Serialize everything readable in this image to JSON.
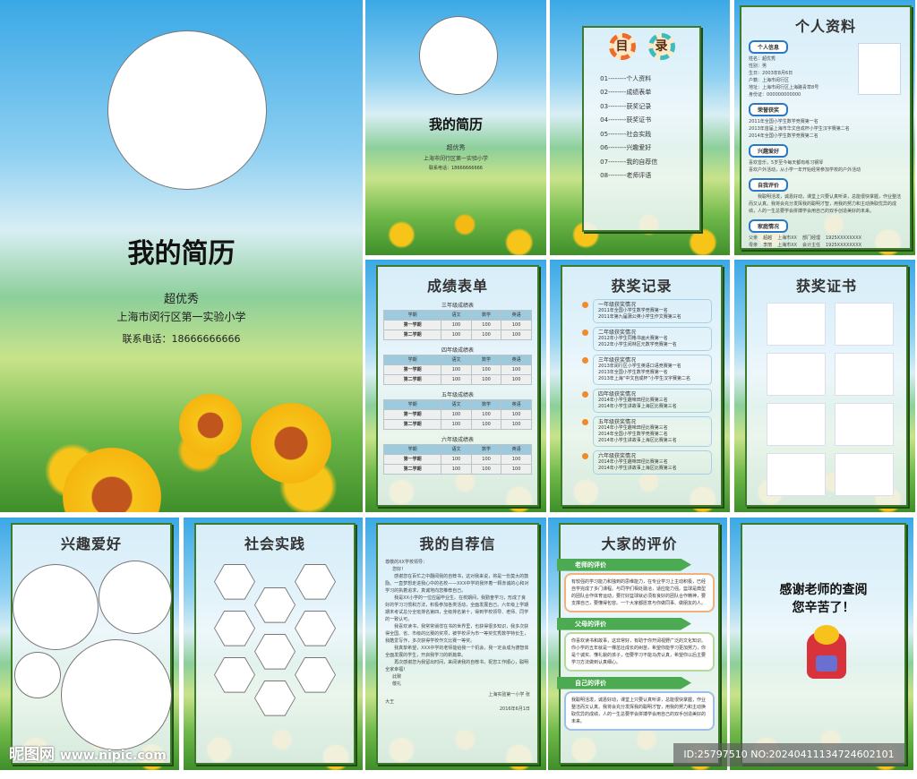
{
  "cover": {
    "title": "我的简历",
    "name": "超优秀",
    "school": "上海市闵行区第一实验小学",
    "phone": "联系电话：18666666666"
  },
  "cover2": {
    "title": "我的简历",
    "name": "超优秀",
    "school": "上海市闵行区第一实验小学",
    "phone": "联系电话：18666666666"
  },
  "toc": {
    "char1": "目",
    "char2": "录",
    "items": [
      {
        "num": "01",
        "label": "个人资料"
      },
      {
        "num": "02",
        "label": "成绩表单"
      },
      {
        "num": "03",
        "label": "获奖记录"
      },
      {
        "num": "04",
        "label": "获奖证书"
      },
      {
        "num": "05",
        "label": "社会实践"
      },
      {
        "num": "06",
        "label": "兴趣爱好"
      },
      {
        "num": "07",
        "label": "我的自荐信"
      },
      {
        "num": "08",
        "label": "老师评语"
      }
    ]
  },
  "profile": {
    "title": "个人资料",
    "sec_info": "个人信息",
    "info": [
      "姓名：超优秀",
      "性别：男",
      "生日：2003年8月6日",
      "户籍：上海市闵行区",
      "地址：上海市闵行区上海路青草8号",
      "身份证：000000000000"
    ],
    "sec_honor": "荣誉获奖",
    "honors": [
      "2011年全国小学生数学竞赛第一名",
      "2013年首届上海市华文自成杯小学生汉字赛第二名",
      "2014年全国小学生数学竞赛第二名"
    ],
    "sec_hobby": "兴趣爱好",
    "hobbies": [
      "喜欢音乐，5岁至今每天都有练习钢琴",
      "喜欢户外活动，从小学一年开始经常参加学校的户外活动"
    ],
    "sec_self": "自我评价",
    "self": "我聪明活泼，诚恳好动，课堂上只要认真听讲，总能很快掌握，作业整洁而又认真。我将会充分发挥我的聪明才智，用我的努力和主动换取优异的成绩，人的一生总要学会拼搏学会用自己的双手创造美好的未来。",
    "sec_family": "家庭情况",
    "family": [
      [
        "父亲",
        "超越",
        "上海市XX",
        "部门经理",
        "1925XXXXXXXX"
      ],
      [
        "母亲",
        "李丽",
        "上海市XX",
        "会计主任",
        "1925XXXXXXXX"
      ]
    ]
  },
  "grades": {
    "title": "成绩表单",
    "headers": [
      "学期",
      "语文",
      "数学",
      "英语"
    ],
    "tables": [
      {
        "caption": "三年级成绩表",
        "rows": [
          [
            "第一学期",
            "100",
            "100",
            "100"
          ],
          [
            "第二学期",
            "100",
            "100",
            "100"
          ]
        ]
      },
      {
        "caption": "四年级成绩表",
        "rows": [
          [
            "第一学期",
            "100",
            "100",
            "100"
          ],
          [
            "第二学期",
            "100",
            "100",
            "100"
          ]
        ]
      },
      {
        "caption": "五年级成绩表",
        "rows": [
          [
            "第一学期",
            "100",
            "100",
            "100"
          ],
          [
            "第二学期",
            "100",
            "100",
            "100"
          ]
        ]
      },
      {
        "caption": "六年级成绩表",
        "rows": [
          [
            "第一学期",
            "100",
            "100",
            "100"
          ],
          [
            "第二学期",
            "100",
            "100",
            "100"
          ]
        ]
      }
    ]
  },
  "awards": {
    "title": "获奖记录",
    "groups": [
      {
        "head": "一年级获奖情况",
        "lines": [
          "2011年全国小学生数学竞赛第一名",
          "2011年第九届蒲公英小学生作文赛第三名"
        ]
      },
      {
        "head": "二年级获奖情况",
        "lines": [
          "2012年小学生同格书画大赛第一名",
          "2012年小学生闵林区元数学竞赛第一名"
        ]
      },
      {
        "head": "三年级获奖情况",
        "lines": [
          "2013年闵行区小学生英语口语竞赛第一名",
          "2013年全国小学生数学竞赛第一名",
          "2013年上海“中文自成杯”小学生汉字赛第二名"
        ]
      },
      {
        "head": "四年级获奖情况",
        "lines": [
          "2014年小学生趣味田径比赛第三名",
          "2014年小学生讲故事上海区比赛第三名"
        ]
      },
      {
        "head": "五年级获奖情况",
        "lines": [
          "2014年小学生趣味田径比赛第三名",
          "2014年全国小学生数学竞赛第二名",
          "2014年小学生讲故事上海区比赛第三名"
        ]
      },
      {
        "head": "六年级获奖情况",
        "lines": [
          "2014年小学生趣味田径比赛第三名",
          "2014年小学生讲故事上海区比赛第三名"
        ]
      }
    ]
  },
  "certs": {
    "title": "获奖证书"
  },
  "hobby": {
    "title": "兴趣爱好"
  },
  "practice": {
    "title": "社会实践"
  },
  "letter": {
    "title": "我的自荐信",
    "greeting": "尊敬的XX学校领导：",
    "hello": "您好！",
    "paras": [
      "感谢您在百忙之中翻阅我的自荐书，这对我来说，将是一份莫大的鼓励。一直梦想走进我心中的名校——XXX中学的我怀着一颗赤诚的心和对学习的执着追求，真诚地向您推荐自己。",
      "我是XX小学的一位应届毕业生。在校期间，我勤奋学习，形成了良好的学习习惯和方法，积极参加各类活动，全面发展自己。六年级上学期期末考试总分全班排名第四，全级排名第十，得到学校领导、老师、同学的一致认可。",
      "我喜欢读书，我常常徜徉在书的世界里，也获得很多知识，我多次获得全国、省、市级的比赛的奖项，被学校评为市一等奖优秀数学特长生，我酷爱写作，多次获得学校作文比赛一等奖。",
      "我真挚希望，XXX中学的老师能给我一个机会，我一定会成为德智体全面发展的学生，开启我学习的新篇章。",
      "再次感谢您为我留出时间，来阅读我的自荐书，祝您工作顺心，聪明全家幸福！"
    ],
    "close1": "此致",
    "close2": "敬礼",
    "sign": "上海实验第一小学 张",
    "date": "2016年6月1日",
    "fill": "大王"
  },
  "eval": {
    "title": "大家的评价",
    "teacher_h": "老师的评价",
    "teacher": "有较强的学习能力和独到的思维能力，在专业学习上主动积极，已经自学完成了多门课程。与同学们相处融洽，适应能力强。篮球是典型的团队合作体育运动，要打好篮球就必须有良好的团队合作精神，要支撑自己，要懂得包容。一个大家都愿意与你做同事、做朋友的人。",
    "parent_h": "父母的评价",
    "parent": "你喜欢读书和故事，这非常好，有助于你开阔视野广泛的文化知识。你小学的五年就是一棵茁壮成长的树苗，希望你能学习更加努力，你是个诚实、懂礼貌的孩子，但要学习不能马虎认真，希望你以后主要学习方法做到认真细心。",
    "self_h": "自己的评价",
    "self": "我聪明活泼，诚恳好动，课堂上只要认真听讲，总能很快掌握，作业整洁而又认真。我将会充分发挥我的聪明才智，用我的努力和主动换取优异的成绩，人的一生总要学会拼搏学会用自己的双手创造美好的未来。"
  },
  "thanks": {
    "line1": "感谢老师的查阅",
    "line2": "您辛苦了！"
  },
  "watermark": {
    "logo": "昵图网",
    "url": "www.nipic.com",
    "id": "ID:25797510 NO:20240411134724602101"
  }
}
